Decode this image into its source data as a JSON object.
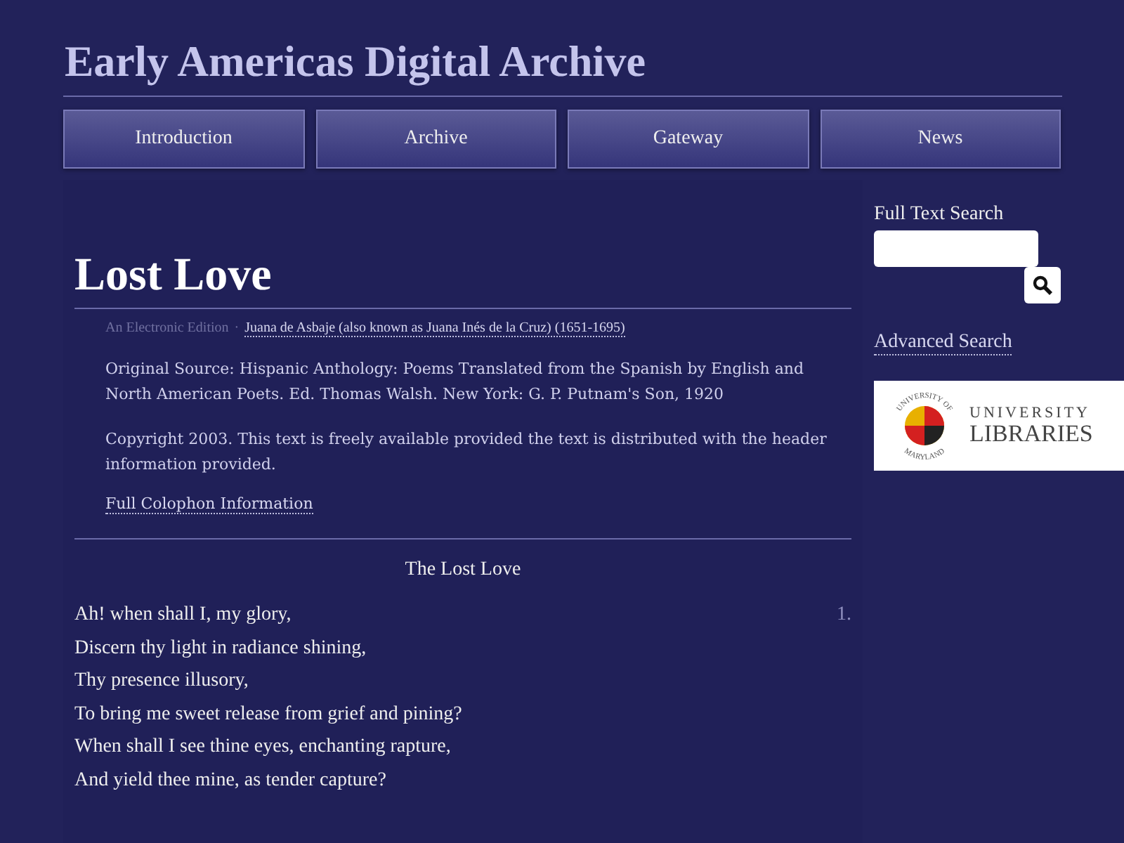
{
  "site_title": "Early Americas Digital Archive",
  "nav": [
    {
      "label": "Introduction"
    },
    {
      "label": "Archive"
    },
    {
      "label": "Gateway"
    },
    {
      "label": "News"
    }
  ],
  "page_title": "Lost Love",
  "edition": {
    "label": "An Electronic Edition",
    "separator": "·",
    "author_link": "Juana de Asbaje (also known as Juana Inés de la Cruz) (1651-1695)"
  },
  "source": "Original Source: Hispanic Anthology: Poems Translated from the Spanish by English and North American Poets. Ed. Thomas Walsh. New York: G. P. Putnam's Son, 1920",
  "copyright": "Copyright 2003. This text is freely available provided the text is distributed with the header information provided.",
  "colophon_link": "Full Colophon Information",
  "poem": {
    "title": "The Lost Love",
    "lines": [
      {
        "text": "Ah! when shall I, my glory,",
        "number": "1."
      },
      {
        "text": "Discern thy light in radiance shining,"
      },
      {
        "text": "Thy presence illusory,"
      },
      {
        "text": "To bring me sweet release from grief and pining?"
      },
      {
        "text": "When shall I see thine eyes, enchanting rapture,"
      },
      {
        "text": "And yield thee mine, as tender capture?"
      }
    ]
  },
  "sidebar": {
    "search_label": "Full Text Search",
    "advanced_link": "Advanced Search",
    "logo": {
      "seal_top": "UNIVERSITY OF",
      "seal_bottom": "MARYLAND",
      "line1": "UNIVERSITY",
      "line2": "LIBRARIES"
    }
  }
}
